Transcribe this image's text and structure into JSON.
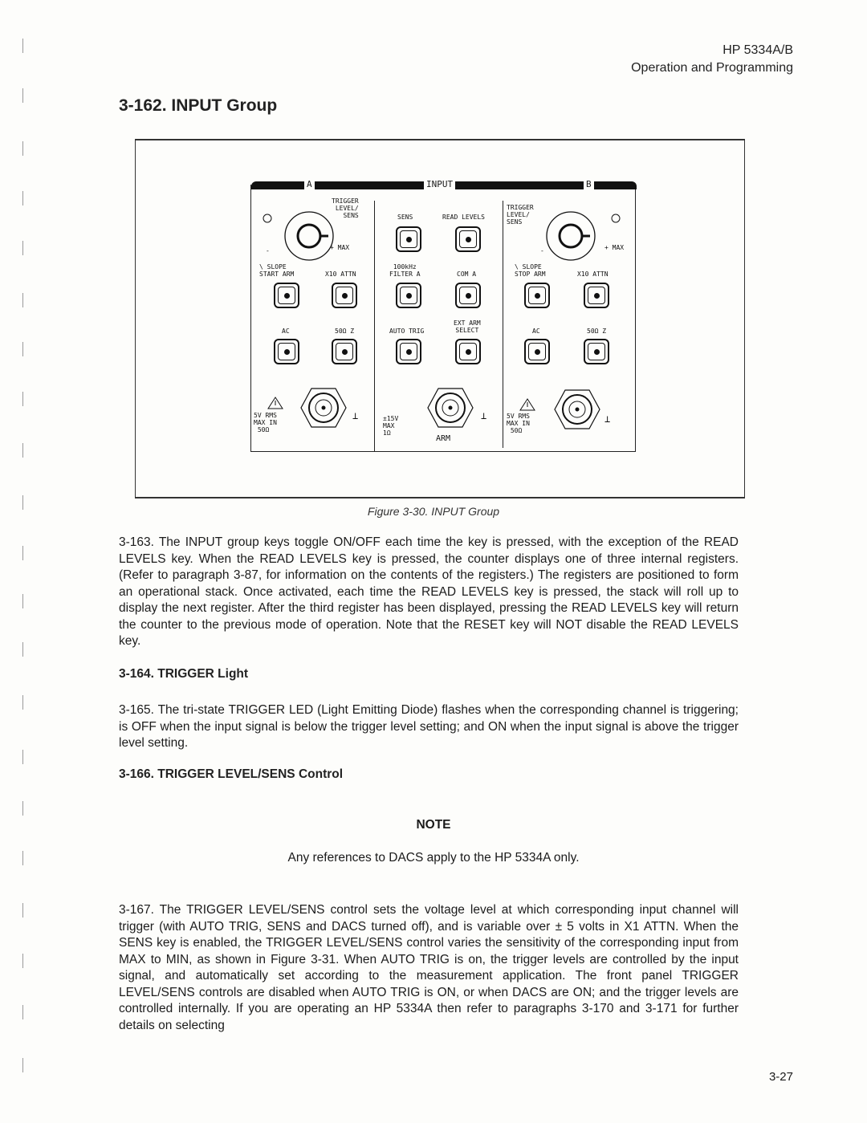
{
  "header": {
    "model": "HP 5334A/B",
    "section": "Operation and Programming"
  },
  "section_title": "3-162.  INPUT Group",
  "figure": {
    "panel_title": "INPUT",
    "channel_a": "A",
    "channel_b": "B",
    "a_labels": {
      "trigger": "TRIGGER\nLEVEL/\n   SENS",
      "minus": "-",
      "plus_max": "+ MAX",
      "slope": "\\ SLOPE\nSTART ARM",
      "x10": "X10 ATTN",
      "ac": "AC",
      "z50": "50Ω Z",
      "input_spec": "5V RMS\nMAX IN\n 50Ω",
      "ground": "⊥"
    },
    "center_labels": {
      "sens": "SENS",
      "read_levels": "READ LEVELS",
      "filter": "100kHz\nFILTER A",
      "com": "COM A",
      "auto_trig": "AUTO TRIG",
      "ext_arm": "EXT ARM\nSELECT",
      "arm_spec": "±15V\nMAX\n1Ω",
      "arm": "ARM",
      "ground": "⊥"
    },
    "b_labels": {
      "trigger": "TRIGGER\nLEVEL/\nSENS",
      "minus": "-",
      "plus_max": "+ MAX",
      "slope": "\\ SLOPE\nSTOP ARM",
      "x10": "X10 ATTN",
      "ac": "AC",
      "z50": "50Ω Z",
      "input_spec": "5V RMS\nMAX IN\n 50Ω",
      "ground": "⊥"
    },
    "caption": "Figure 3-30.  INPUT Group"
  },
  "paragraphs": {
    "p163": "3-163.  The INPUT group keys toggle ON/OFF each time the key is pressed, with the exception of the READ LEVELS key. When the READ LEVELS key is pressed, the counter displays one of three internal registers. (Refer to paragraph 3-87, for information on the contents of the registers.) The registers are positioned to form an operational stack. Once activated, each time the READ LEVELS key is pressed, the stack will roll up to display the next register. After the third register has been displayed, pressing the READ LEVELS key will return the counter to the previous mode of operation. Note that the RESET key will NOT disable the READ LEVELS key.",
    "h164": "3-164.  TRIGGER Light",
    "p165": "3-165.  The tri-state TRIGGER LED (Light Emitting Diode) flashes when the corresponding channel is triggering; is OFF when the input signal is below the trigger level setting; and ON when the input signal is above the trigger level setting.",
    "h166": "3-166.  TRIGGER LEVEL/SENS Control",
    "note_title": "NOTE",
    "note_text": "Any references to DACS apply to the HP 5334A only.",
    "p167": "3-167.  The TRIGGER LEVEL/SENS control sets the voltage level at which corresponding input channel will trigger (with AUTO TRIG, SENS and DACS turned off), and is variable over ± 5 volts in X1 ATTN. When the SENS key is enabled, the TRIGGER LEVEL/SENS control varies the sensitivity of the corresponding input from MAX to MIN, as shown in Figure 3-31. When AUTO TRIG is on, the trigger levels are controlled by the input signal, and automatically set according to the measurement application. The front panel TRIGGER LEVEL/SENS controls are disabled when AUTO TRIG is ON, or when DACS are ON; and the trigger levels are controlled internally. If you are operating an HP 5334A then refer to paragraphs 3-170 and 3-171 for further details on selecting"
  },
  "page_number": "3-27"
}
